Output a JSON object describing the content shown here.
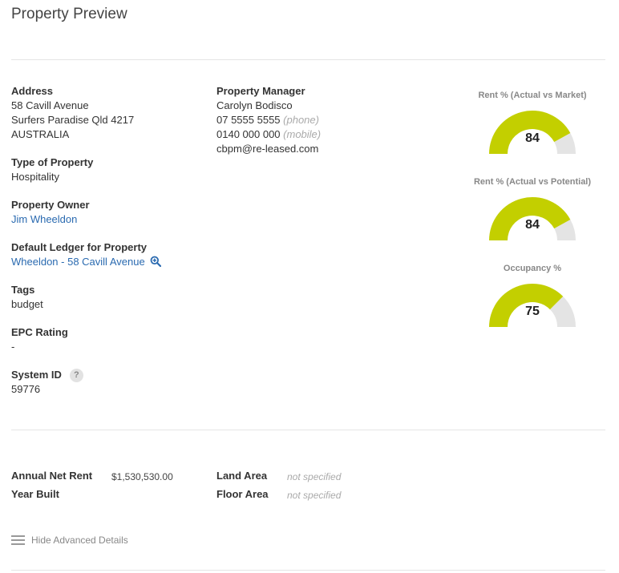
{
  "page": {
    "title": "Property Preview"
  },
  "details": {
    "address": {
      "label": "Address",
      "line1": "58 Cavill Avenue",
      "line2": "Surfers Paradise Qld 4217",
      "line3": "AUSTRALIA"
    },
    "type": {
      "label": "Type of Property",
      "value": "Hospitality"
    },
    "owner": {
      "label": "Property Owner",
      "value": "Jim Wheeldon"
    },
    "ledger": {
      "label": "Default Ledger for Property",
      "value": "Wheeldon - 58 Cavill Avenue"
    },
    "tags": {
      "label": "Tags",
      "value": "budget"
    },
    "epc": {
      "label": "EPC Rating",
      "value": "-"
    },
    "system_id": {
      "label": "System ID",
      "help": "?",
      "value": "59776"
    }
  },
  "manager": {
    "label": "Property Manager",
    "name": "Carolyn Bodisco",
    "phone": "07 5555 5555",
    "phone_hint": "(phone)",
    "mobile": "0140 000 000",
    "mobile_hint": "(mobile)",
    "email": "cbpm@re-leased.com"
  },
  "gauges": [
    {
      "title": "Rent % (Actual vs Market)",
      "value": 84,
      "display": "84",
      "fill_color": "#c3cf00",
      "track_color": "#e4e4e4"
    },
    {
      "title": "Rent % (Actual vs Potential)",
      "value": 84,
      "display": "84",
      "fill_color": "#c3cf00",
      "track_color": "#e4e4e4"
    },
    {
      "title": "Occupancy %",
      "value": 75,
      "display": "75",
      "fill_color": "#c3cf00",
      "track_color": "#e4e4e4"
    }
  ],
  "advanced": {
    "annual_net_rent": {
      "label": "Annual Net Rent",
      "value": "$1,530,530.00"
    },
    "year_built": {
      "label": "Year Built",
      "value": ""
    },
    "land_area": {
      "label": "Land Area",
      "value": "not specified"
    },
    "floor_area": {
      "label": "Floor Area",
      "value": "not specified"
    }
  },
  "toggle": {
    "label": "Hide Advanced Details",
    "icon": "menu-icon"
  }
}
